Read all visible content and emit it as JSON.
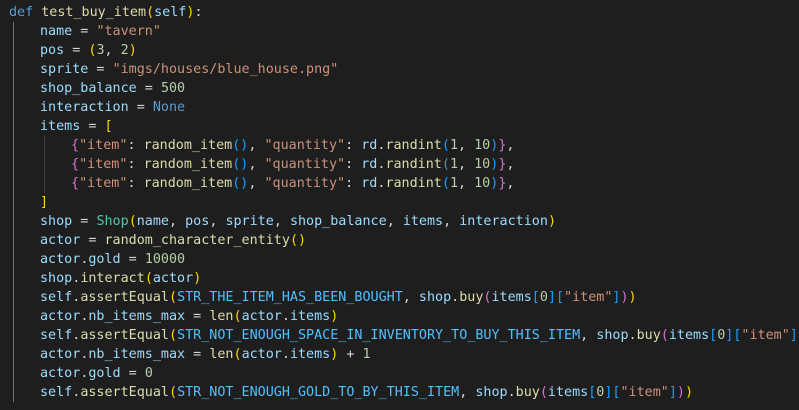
{
  "editor": {
    "language": "python",
    "theme_colors": {
      "background": "#1e1e1e",
      "keyword": "#569cd6",
      "function": "#dcdcaa",
      "variable": "#9cdcfe",
      "string": "#ce9178",
      "number": "#b5cea8",
      "class": "#4ec9b0",
      "constant": "#4fc1ff",
      "bracket_level_1": "#ffd700",
      "bracket_level_2": "#da70d6",
      "bracket_level_3": "#179fff"
    },
    "lines": [
      {
        "indent": 0,
        "tokens": [
          [
            "kw",
            "def"
          ],
          [
            "op",
            " "
          ],
          [
            "fn",
            "test_buy_item"
          ],
          [
            "b1",
            "("
          ],
          [
            "var",
            "self"
          ],
          [
            "b1",
            ")"
          ],
          [
            "op",
            ":"
          ]
        ]
      },
      {
        "indent": 1,
        "tokens": [
          [
            "var",
            "name"
          ],
          [
            "op",
            " = "
          ],
          [
            "str",
            "\"tavern\""
          ]
        ]
      },
      {
        "indent": 1,
        "tokens": [
          [
            "var",
            "pos"
          ],
          [
            "op",
            " = "
          ],
          [
            "b1",
            "("
          ],
          [
            "num",
            "3"
          ],
          [
            "op",
            ", "
          ],
          [
            "num",
            "2"
          ],
          [
            "b1",
            ")"
          ]
        ]
      },
      {
        "indent": 1,
        "tokens": [
          [
            "var",
            "sprite"
          ],
          [
            "op",
            " = "
          ],
          [
            "str",
            "\"imgs/houses/blue_house.png\""
          ]
        ]
      },
      {
        "indent": 1,
        "tokens": [
          [
            "var",
            "shop_balance"
          ],
          [
            "op",
            " = "
          ],
          [
            "num",
            "500"
          ]
        ]
      },
      {
        "indent": 1,
        "tokens": [
          [
            "var",
            "interaction"
          ],
          [
            "op",
            " = "
          ],
          [
            "kw",
            "None"
          ]
        ]
      },
      {
        "indent": 1,
        "tokens": [
          [
            "var",
            "items"
          ],
          [
            "op",
            " = "
          ],
          [
            "b1",
            "["
          ]
        ]
      },
      {
        "indent": 2,
        "tokens": [
          [
            "b2",
            "{"
          ],
          [
            "str",
            "\"item\""
          ],
          [
            "op",
            ": "
          ],
          [
            "fn",
            "random_item"
          ],
          [
            "b3",
            "()"
          ],
          [
            "op",
            ", "
          ],
          [
            "str",
            "\"quantity\""
          ],
          [
            "op",
            ": "
          ],
          [
            "var",
            "rd"
          ],
          [
            "op",
            "."
          ],
          [
            "fn",
            "randint"
          ],
          [
            "b3",
            "("
          ],
          [
            "num",
            "1"
          ],
          [
            "op",
            ", "
          ],
          [
            "num",
            "10"
          ],
          [
            "b3",
            ")"
          ],
          [
            "b2",
            "}"
          ],
          [
            "op",
            ","
          ]
        ]
      },
      {
        "indent": 2,
        "tokens": [
          [
            "b2",
            "{"
          ],
          [
            "str",
            "\"item\""
          ],
          [
            "op",
            ": "
          ],
          [
            "fn",
            "random_item"
          ],
          [
            "b3",
            "()"
          ],
          [
            "op",
            ", "
          ],
          [
            "str",
            "\"quantity\""
          ],
          [
            "op",
            ": "
          ],
          [
            "var",
            "rd"
          ],
          [
            "op",
            "."
          ],
          [
            "fn",
            "randint"
          ],
          [
            "b3",
            "("
          ],
          [
            "num",
            "1"
          ],
          [
            "op",
            ", "
          ],
          [
            "num",
            "10"
          ],
          [
            "b3",
            ")"
          ],
          [
            "b2",
            "}"
          ],
          [
            "op",
            ","
          ]
        ]
      },
      {
        "indent": 2,
        "tokens": [
          [
            "b2",
            "{"
          ],
          [
            "str",
            "\"item\""
          ],
          [
            "op",
            ": "
          ],
          [
            "fn",
            "random_item"
          ],
          [
            "b3",
            "()"
          ],
          [
            "op",
            ", "
          ],
          [
            "str",
            "\"quantity\""
          ],
          [
            "op",
            ": "
          ],
          [
            "var",
            "rd"
          ],
          [
            "op",
            "."
          ],
          [
            "fn",
            "randint"
          ],
          [
            "b3",
            "("
          ],
          [
            "num",
            "1"
          ],
          [
            "op",
            ", "
          ],
          [
            "num",
            "10"
          ],
          [
            "b3",
            ")"
          ],
          [
            "b2",
            "}"
          ],
          [
            "op",
            ","
          ]
        ]
      },
      {
        "indent": 1,
        "tokens": [
          [
            "b1",
            "]"
          ]
        ]
      },
      {
        "indent": 1,
        "tokens": [
          [
            "var",
            "shop"
          ],
          [
            "op",
            " = "
          ],
          [
            "cls",
            "Shop"
          ],
          [
            "b1",
            "("
          ],
          [
            "var",
            "name"
          ],
          [
            "op",
            ", "
          ],
          [
            "var",
            "pos"
          ],
          [
            "op",
            ", "
          ],
          [
            "var",
            "sprite"
          ],
          [
            "op",
            ", "
          ],
          [
            "var",
            "shop_balance"
          ],
          [
            "op",
            ", "
          ],
          [
            "var",
            "items"
          ],
          [
            "op",
            ", "
          ],
          [
            "var",
            "interaction"
          ],
          [
            "b1",
            ")"
          ]
        ]
      },
      {
        "indent": 1,
        "tokens": [
          [
            "var",
            "actor"
          ],
          [
            "op",
            " = "
          ],
          [
            "fn",
            "random_character_entity"
          ],
          [
            "b1",
            "()"
          ]
        ]
      },
      {
        "indent": 1,
        "tokens": [
          [
            "var",
            "actor"
          ],
          [
            "op",
            "."
          ],
          [
            "var",
            "gold"
          ],
          [
            "op",
            " = "
          ],
          [
            "num",
            "10000"
          ]
        ]
      },
      {
        "indent": 1,
        "tokens": [
          [
            "var",
            "shop"
          ],
          [
            "op",
            "."
          ],
          [
            "fn",
            "interact"
          ],
          [
            "b1",
            "("
          ],
          [
            "var",
            "actor"
          ],
          [
            "b1",
            ")"
          ]
        ]
      },
      {
        "indent": 1,
        "tokens": [
          [
            "var",
            "self"
          ],
          [
            "op",
            "."
          ],
          [
            "fn",
            "assertEqual"
          ],
          [
            "b1",
            "("
          ],
          [
            "const",
            "STR_THE_ITEM_HAS_BEEN_BOUGHT"
          ],
          [
            "op",
            ", "
          ],
          [
            "var",
            "shop"
          ],
          [
            "op",
            "."
          ],
          [
            "fn",
            "buy"
          ],
          [
            "b2",
            "("
          ],
          [
            "var",
            "items"
          ],
          [
            "b3",
            "["
          ],
          [
            "num",
            "0"
          ],
          [
            "b3",
            "]"
          ],
          [
            "b3",
            "["
          ],
          [
            "str",
            "\"item\""
          ],
          [
            "b3",
            "]"
          ],
          [
            "b2",
            ")"
          ],
          [
            "b1",
            ")"
          ]
        ]
      },
      {
        "indent": 1,
        "tokens": [
          [
            "var",
            "actor"
          ],
          [
            "op",
            "."
          ],
          [
            "var",
            "nb_items_max"
          ],
          [
            "op",
            " = "
          ],
          [
            "fn",
            "len"
          ],
          [
            "b1",
            "("
          ],
          [
            "var",
            "actor"
          ],
          [
            "op",
            "."
          ],
          [
            "var",
            "items"
          ],
          [
            "b1",
            ")"
          ]
        ]
      },
      {
        "indent": 1,
        "tokens": [
          [
            "var",
            "self"
          ],
          [
            "op",
            "."
          ],
          [
            "fn",
            "assertEqual"
          ],
          [
            "b1",
            "("
          ],
          [
            "const",
            "STR_NOT_ENOUGH_SPACE_IN_INVENTORY_TO_BUY_THIS_ITEM"
          ],
          [
            "op",
            ", "
          ],
          [
            "var",
            "shop"
          ],
          [
            "op",
            "."
          ],
          [
            "fn",
            "buy"
          ],
          [
            "b2",
            "("
          ],
          [
            "var",
            "items"
          ],
          [
            "b3",
            "["
          ],
          [
            "num",
            "0"
          ],
          [
            "b3",
            "]"
          ],
          [
            "b3",
            "["
          ],
          [
            "str",
            "\"item\""
          ],
          [
            "b3",
            "]"
          ],
          [
            "b2",
            ")"
          ],
          [
            "b1",
            ")"
          ]
        ]
      },
      {
        "indent": 1,
        "tokens": [
          [
            "var",
            "actor"
          ],
          [
            "op",
            "."
          ],
          [
            "var",
            "nb_items_max"
          ],
          [
            "op",
            " = "
          ],
          [
            "fn",
            "len"
          ],
          [
            "b1",
            "("
          ],
          [
            "var",
            "actor"
          ],
          [
            "op",
            "."
          ],
          [
            "var",
            "items"
          ],
          [
            "b1",
            ")"
          ],
          [
            "op",
            " + "
          ],
          [
            "num",
            "1"
          ]
        ]
      },
      {
        "indent": 1,
        "tokens": [
          [
            "var",
            "actor"
          ],
          [
            "op",
            "."
          ],
          [
            "var",
            "gold"
          ],
          [
            "op",
            " = "
          ],
          [
            "num",
            "0"
          ]
        ]
      },
      {
        "indent": 1,
        "tokens": [
          [
            "var",
            "self"
          ],
          [
            "op",
            "."
          ],
          [
            "fn",
            "assertEqual"
          ],
          [
            "b1",
            "("
          ],
          [
            "const",
            "STR_NOT_ENOUGH_GOLD_TO_BY_THIS_ITEM"
          ],
          [
            "op",
            ", "
          ],
          [
            "var",
            "shop"
          ],
          [
            "op",
            "."
          ],
          [
            "fn",
            "buy"
          ],
          [
            "b2",
            "("
          ],
          [
            "var",
            "items"
          ],
          [
            "b3",
            "["
          ],
          [
            "num",
            "0"
          ],
          [
            "b3",
            "]"
          ],
          [
            "b3",
            "["
          ],
          [
            "str",
            "\"item\""
          ],
          [
            "b3",
            "]"
          ],
          [
            "b2",
            ")"
          ],
          [
            "b1",
            ")"
          ]
        ]
      }
    ]
  }
}
